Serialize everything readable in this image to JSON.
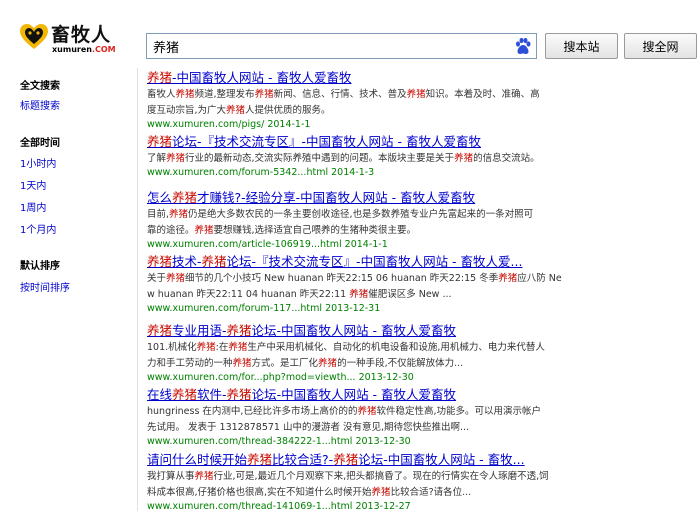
{
  "logo": {
    "name": "畜牧人",
    "sub_main": "xumuren",
    "sub_com": ".COM"
  },
  "search": {
    "value": "养猪",
    "btn_site": "搜本站",
    "btn_net": "搜全网"
  },
  "sidebar": {
    "group1": {
      "items": [
        "全文搜索",
        "标题搜索"
      ]
    },
    "group2": {
      "head": "全部时间",
      "items": [
        "1小时内",
        "1天内",
        "1周内",
        "1个月内"
      ]
    },
    "group3": {
      "head": "默认排序",
      "items": [
        "按时间排序"
      ]
    }
  },
  "colors": {
    "link": "#0000cc",
    "keyword": "#c60a00",
    "url": "#008000"
  },
  "results": [
    {
      "title": [
        [
          "养猪",
          "kw"
        ],
        [
          "-中国畜牧人网站 - 畜牧人爱畜牧",
          ""
        ]
      ],
      "desc": [
        [
          [
            "畜牧人",
            ""
          ],
          [
            "养猪",
            "kw"
          ],
          [
            "频道,整理发布",
            ""
          ],
          [
            "养猪",
            "kw"
          ],
          [
            "新闻、信息、行情、技术、普及",
            ""
          ],
          [
            "养猪",
            "kw"
          ],
          [
            "知识。本着及时、准确、高",
            ""
          ]
        ],
        [
          [
            "度互动宗旨,为广大",
            ""
          ],
          [
            "养猪",
            "kw"
          ],
          [
            "人提供优质的服务。",
            ""
          ]
        ]
      ],
      "url": "www.xumuren.com/pigs/ 2014-1-1"
    },
    {
      "title": [
        [
          "养猪",
          "kw"
        ],
        [
          "论坛-『技术交流专区』-中国畜牧人网站 - 畜牧人爱畜牧",
          ""
        ]
      ],
      "desc": [
        [
          [
            "了解",
            ""
          ],
          [
            "养猪",
            "kw"
          ],
          [
            "行业的最新动态,交流实际养殖中遇到的问题。本版块主要是关于",
            ""
          ],
          [
            "养猪",
            "kw"
          ],
          [
            "的信息交流站。",
            ""
          ]
        ]
      ],
      "url": "www.xumuren.com/forum-5342...html 2014-1-3"
    },
    {
      "title": [
        [
          "怎么",
          ""
        ],
        [
          "养猪",
          "kw"
        ],
        [
          "才赚钱?-经验分享-中国畜牧人网站 - 畜牧人爱畜牧",
          ""
        ]
      ],
      "desc": [
        [
          [
            "目前,",
            ""
          ],
          [
            "养猪",
            "kw"
          ],
          [
            "仍是绝大多数农民的一条主要创收途径,也是多数养殖专业户先富起来的一条对照可",
            ""
          ]
        ],
        [
          [
            "靠的途径。",
            ""
          ],
          [
            "养猪",
            "kw"
          ],
          [
            "要想赚钱,选择适宜自己喂养的生猪种类很主要。",
            ""
          ]
        ]
      ],
      "url": "www.xumuren.com/article-106919...html 2014-1-1"
    },
    {
      "title": [
        [
          "养猪",
          "kw"
        ],
        [
          "技术-",
          ""
        ],
        [
          "养猪",
          "kw"
        ],
        [
          "论坛-『技术交流专区』-中国畜牧人网站 - 畜牧人爱...",
          ""
        ]
      ],
      "desc": [
        [
          [
            "关于",
            ""
          ],
          [
            "养猪",
            "kw"
          ],
          [
            "细节的几个小技巧 New huanan 昨天22:15 06 huanan 昨天22:15 冬季",
            ""
          ],
          [
            "养猪",
            "kw"
          ],
          [
            "应八防 Ne",
            ""
          ]
        ],
        [
          [
            "w huanan 昨天22:11 04 huanan 昨天22:11 ",
            ""
          ],
          [
            "养猪",
            "kw"
          ],
          [
            "催肥误区多 New ...",
            ""
          ]
        ]
      ],
      "url": "www.xumuren.com/forum-117...html 2013-12-31"
    },
    {
      "title": [
        [
          "养猪",
          "kw"
        ],
        [
          "专业用语-",
          ""
        ],
        [
          "养猪",
          "kw"
        ],
        [
          "论坛-中国畜牧人网站 - 畜牧人爱畜牧",
          ""
        ]
      ],
      "desc": [
        [
          [
            "101.机械化",
            ""
          ],
          [
            "养猪",
            "kw"
          ],
          [
            ":在",
            ""
          ],
          [
            "养猪",
            "kw"
          ],
          [
            "生产中采用机械化、自动化的机电设备和设施,用机械力、电力来代替人",
            ""
          ]
        ],
        [
          [
            "力和手工劳动的一种",
            ""
          ],
          [
            "养猪",
            "kw"
          ],
          [
            "方式。是工厂化",
            ""
          ],
          [
            "养猪",
            "kw"
          ],
          [
            "的一种手段,不仅能解放体力...",
            ""
          ]
        ]
      ],
      "url": "www.xumuren.com/for...php?mod=viewth... 2013-12-30"
    },
    {
      "title": [
        [
          "在线",
          ""
        ],
        [
          "养猪",
          "kw"
        ],
        [
          "软件-",
          ""
        ],
        [
          "养猪",
          "kw"
        ],
        [
          "论坛-中国畜牧人网站 - 畜牧人爱畜牧",
          ""
        ]
      ],
      "desc": [
        [
          [
            "hungriness 在内测中,已经比许多市场上高价的的",
            ""
          ],
          [
            "养猪",
            "kw"
          ],
          [
            "软件稳定性高,功能多。可以用演示帐户",
            ""
          ]
        ],
        [
          [
            "先试用。 发表于 1312878571 山中的漫游者 没有意见,期待您快些推出啊...",
            ""
          ]
        ]
      ],
      "url": "www.xumuren.com/thread-384222-1...html 2013-12-30"
    },
    {
      "title": [
        [
          "请问什么时候开始",
          ""
        ],
        [
          "养猪",
          "kw"
        ],
        [
          "比较合适?-",
          ""
        ],
        [
          "养猪",
          "kw"
        ],
        [
          "论坛-中国畜牧人网站 - 畜牧...",
          ""
        ]
      ],
      "desc": [
        [
          [
            "我打算从事",
            ""
          ],
          [
            "养猪",
            "kw"
          ],
          [
            "行业,可是,最近几个月观察下来,把头都搞昏了。现在的行情实在令人琢磨不透,饲",
            ""
          ]
        ],
        [
          [
            "料成本很高,仔猪价格也很高,实在不知道什么时候开始",
            ""
          ],
          [
            "养猪",
            "kw"
          ],
          [
            "比较合适?请各位...",
            ""
          ]
        ]
      ],
      "url": "www.xumuren.com/thread-141069-1...html 2013-12-27"
    }
  ]
}
